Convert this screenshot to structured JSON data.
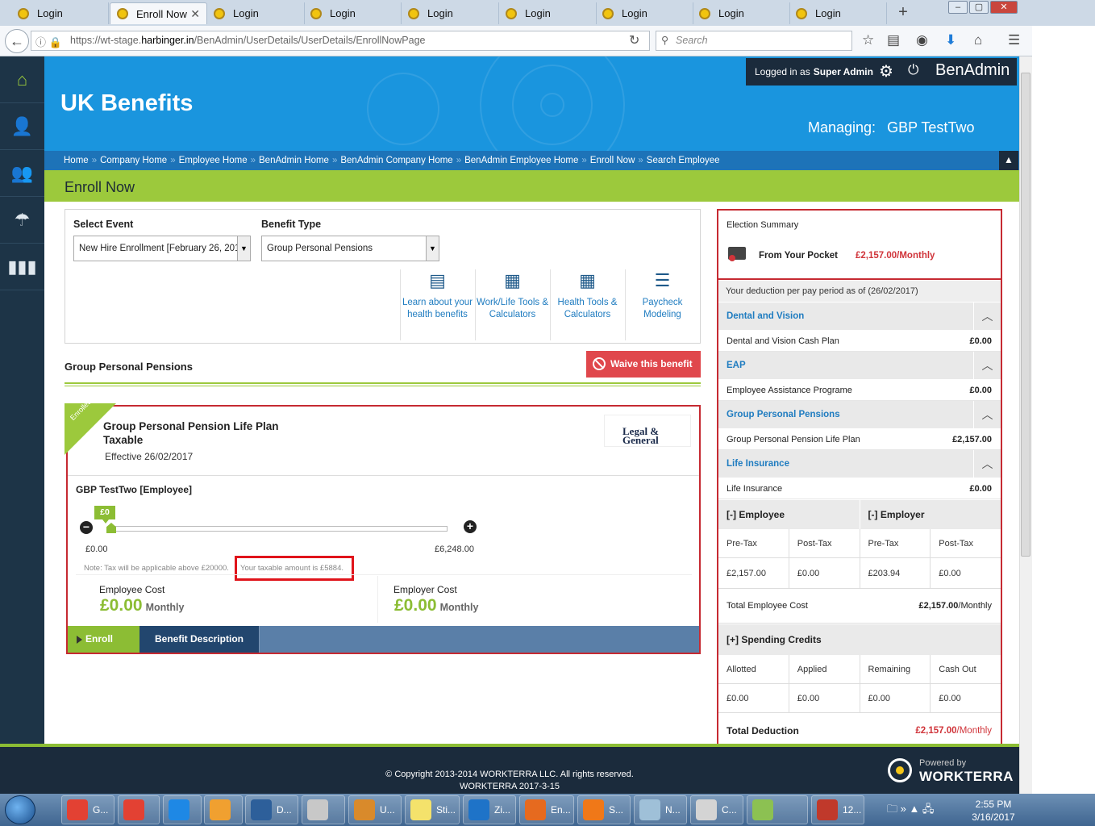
{
  "browser": {
    "tabs": [
      {
        "label": "Login"
      },
      {
        "label": "Enroll Now"
      },
      {
        "label": "Login"
      },
      {
        "label": "Login"
      },
      {
        "label": "Login"
      },
      {
        "label": "Login"
      },
      {
        "label": "Login"
      },
      {
        "label": "Login"
      },
      {
        "label": "Login"
      }
    ],
    "url_prefix": "https://wt-stage.",
    "url_host": "harbinger.in",
    "url_path": "/BenAdmin/UserDetails/UserDetails/EnrollNowPage",
    "search_placeholder": "Search"
  },
  "header": {
    "app_title": "UK Benefits",
    "logged_in_prefix": "Logged in as",
    "logged_in_user": "Super Admin",
    "brand": "BenAdmin",
    "managing_label": "Managing:",
    "managing_name": "GBP TestTwo"
  },
  "breadcrumb": [
    "Home",
    "Company Home",
    "Employee Home",
    "BenAdmin Home",
    "BenAdmin Company Home",
    "BenAdmin Employee Home",
    "Enroll Now",
    "Search Employee"
  ],
  "page_title": "Enroll Now",
  "selectors": {
    "event_label": "Select Event",
    "event_value": "New Hire Enrollment [February 26, 201",
    "benefit_type_label": "Benefit Type",
    "benefit_type_value": "Group Personal Pensions"
  },
  "tools": [
    {
      "label": "Learn about your health benefits",
      "icon": "document-icon"
    },
    {
      "label": "Work/Life Tools & Calculators",
      "icon": "calculator-icon"
    },
    {
      "label": "Health Tools & Calculators",
      "icon": "calculator-icon"
    },
    {
      "label": "Paycheck Modeling",
      "icon": "money-stack-icon"
    }
  ],
  "section_title": "Group Personal Pensions",
  "waive_label": "Waive this benefit",
  "plan": {
    "ribbon": "Enrolled",
    "name_line1": "Group Personal Pension Life Plan",
    "name_line2": "Taxable",
    "effective": "Effective 26/02/2017",
    "provider_logo_line1": "Legal &",
    "provider_logo_line2": "General",
    "employee": "GBP TestTwo [Employee]",
    "slider_value_label": "£0",
    "slider_min": "£0.00",
    "slider_max": "£6,248.00",
    "slider_fraction": 0,
    "note": "Note: Tax will be applicable above £20000.",
    "taxable_note": "Your taxable amount is £5884.",
    "employee_cost_label": "Employee Cost",
    "employee_cost_value": "£0.00",
    "employer_cost_label": "Employer Cost",
    "employer_cost_value": "£0.00",
    "period": "Monthly",
    "enroll_label": "Enroll",
    "description_label": "Benefit Description"
  },
  "summary": {
    "title": "Election Summary",
    "pocket_label": "From Your Pocket",
    "pocket_value": "£2,157.00/Monthly",
    "deduction_note": "Your deduction per pay period as of (26/02/2017)",
    "sections": [
      {
        "title": "Dental and Vision",
        "row_label": "Dental and Vision Cash Plan",
        "row_value": "£0.00"
      },
      {
        "title": "EAP",
        "row_label": "Employee Assistance Programe",
        "row_value": "£0.00"
      },
      {
        "title": "Group Personal Pensions",
        "row_label": "Group Personal Pension Life Plan",
        "row_value": "£2,157.00"
      },
      {
        "title": "Life Insurance",
        "row_label": "Life Insurance",
        "row_value": "£0.00"
      }
    ],
    "employee_header": "[-] Employee",
    "employer_header": "[-] Employer",
    "tax_headers": [
      "Pre-Tax",
      "Post-Tax",
      "Pre-Tax",
      "Post-Tax"
    ],
    "tax_values": [
      "£2,157.00",
      "£0.00",
      "£203.94",
      "£0.00"
    ],
    "total_employee_label": "Total Employee Cost",
    "total_employee_value": "£2,157.00",
    "total_employee_suffix": "/Monthly",
    "spending_header": "[+] Spending Credits",
    "credit_headers": [
      "Allotted",
      "Applied",
      "Remaining",
      "Cash Out"
    ],
    "credit_values": [
      "£0.00",
      "£0.00",
      "£0.00",
      "£0.00"
    ],
    "total_deduction_label": "Total Deduction",
    "total_deduction_value": "£2,157.00",
    "total_deduction_suffix": "/Monthly"
  },
  "footer": {
    "copyright": "© Copyright 2013-2014 WORKTERRA LLC. All rights reserved.",
    "version": "WORKTERRA 2017-3-15",
    "powered_by": "Powered by",
    "powered_brand": "WORKTERRA"
  },
  "taskbar": {
    "items": [
      {
        "label": "G...",
        "color": "#e34133"
      },
      {
        "label": "",
        "color": "#e34133"
      },
      {
        "label": "",
        "color": "#1e88e5"
      },
      {
        "label": "",
        "color": "#f0a030"
      },
      {
        "label": "D...",
        "color": "#2d5f9a"
      },
      {
        "label": "",
        "color": "#c8c8c8"
      },
      {
        "label": "U...",
        "color": "#d98a2b"
      },
      {
        "label": "Sti...",
        "color": "#f4e26b"
      },
      {
        "label": "Zi...",
        "color": "#1e73c8"
      },
      {
        "label": "En...",
        "color": "#e66a1f"
      },
      {
        "label": "S...",
        "color": "#f07818"
      },
      {
        "label": "N...",
        "color": "#9fc0d8"
      },
      {
        "label": "C...",
        "color": "#d4d4d4"
      },
      {
        "label": "",
        "color": "#8cc152"
      },
      {
        "label": "12...",
        "color": "#c0392b"
      }
    ],
    "time": "2:55 PM",
    "date": "3/16/2017"
  }
}
